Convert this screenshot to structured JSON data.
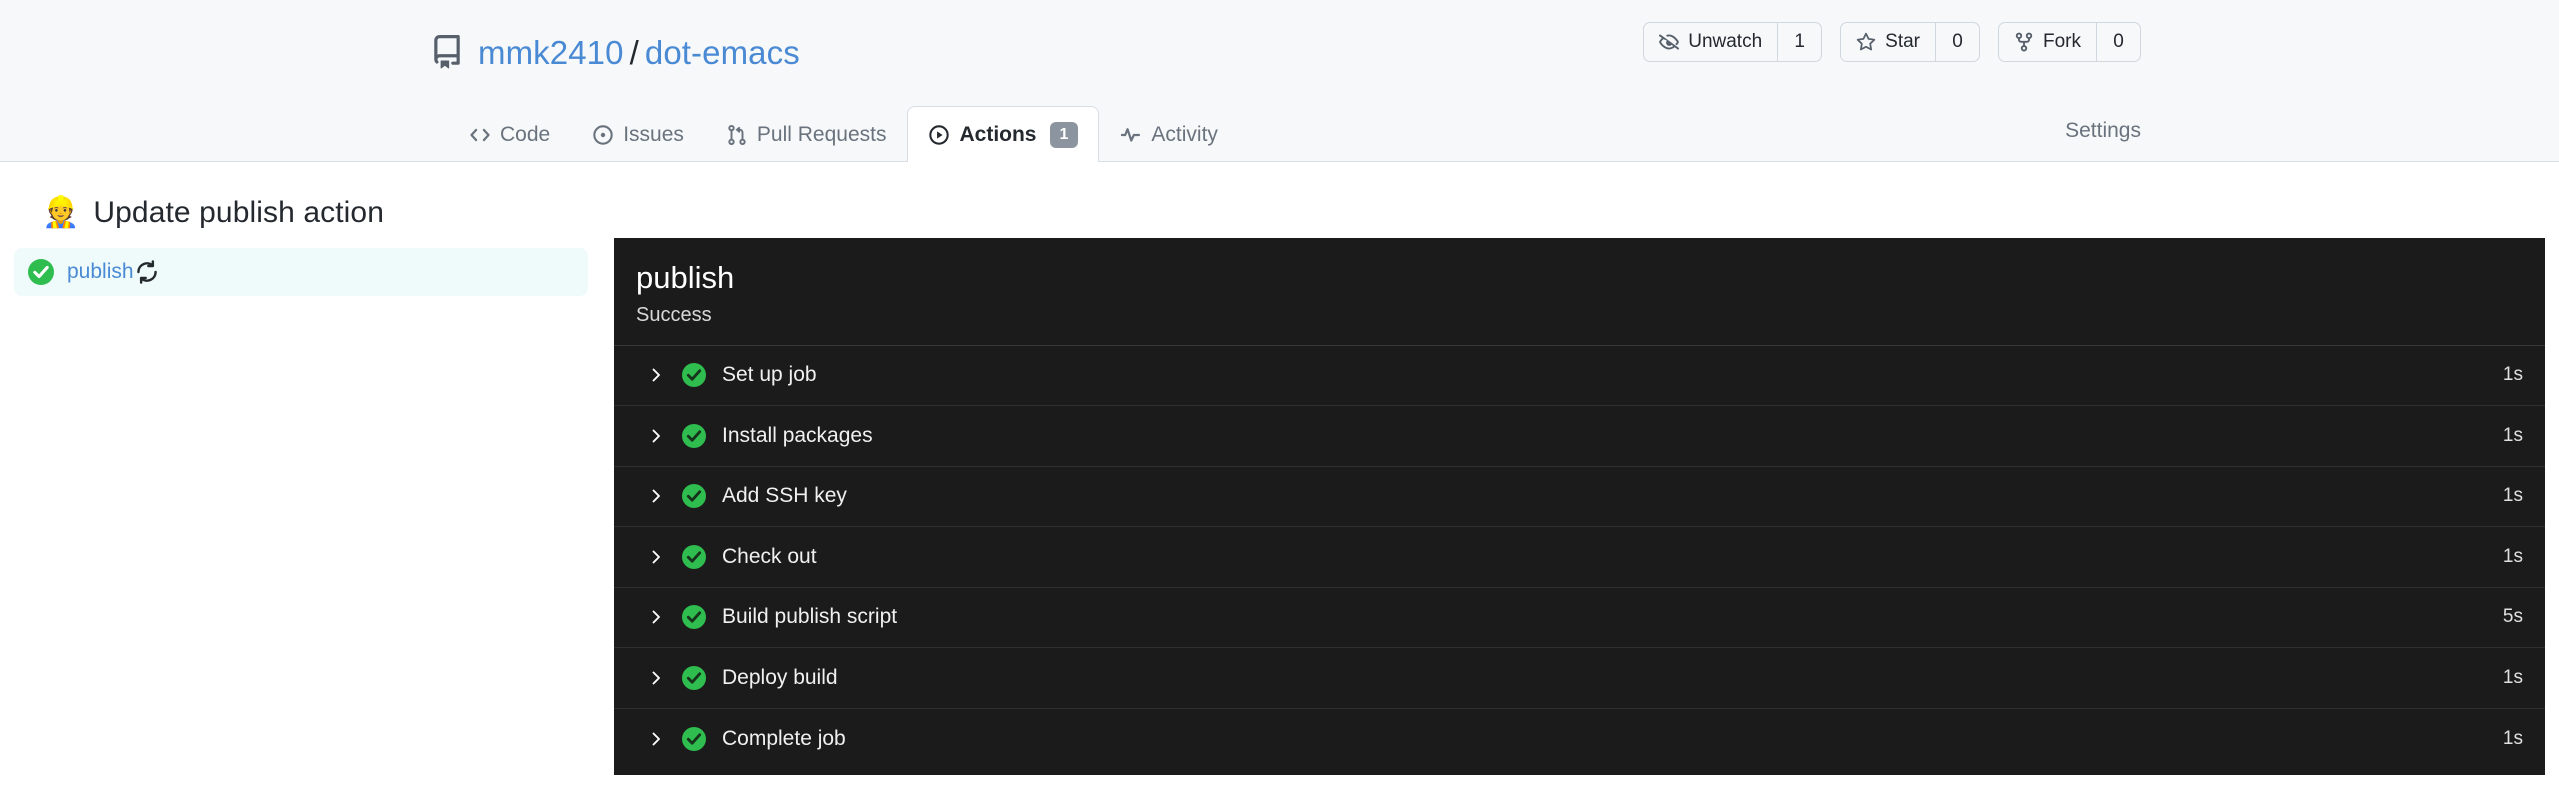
{
  "header": {
    "repo_icon": "repo-book-icon",
    "owner": "mmk2410",
    "separator": "/",
    "repo": "dot-emacs",
    "actions": [
      {
        "icon": "eye-closed-icon",
        "label": "Unwatch",
        "count": "1"
      },
      {
        "icon": "star-icon",
        "label": "Star",
        "count": "0"
      },
      {
        "icon": "fork-icon",
        "label": "Fork",
        "count": "0"
      }
    ],
    "tabs": [
      {
        "icon": "code-icon",
        "label": "Code",
        "badge": "",
        "active": false
      },
      {
        "icon": "issue-opened-icon",
        "label": "Issues",
        "badge": "",
        "active": false
      },
      {
        "icon": "git-pull-request-icon",
        "label": "Pull Requests",
        "badge": "",
        "active": false
      },
      {
        "icon": "play-circle-icon",
        "label": "Actions",
        "badge": "1",
        "active": true
      },
      {
        "icon": "pulse-icon",
        "label": "Activity",
        "badge": "",
        "active": false
      }
    ],
    "settings": {
      "icon": "wrench-icon",
      "label": "Settings"
    }
  },
  "page": {
    "emoji": "👷",
    "title": "Update publish action"
  },
  "sidebar": {
    "jobs": [
      {
        "status_icon": "check-circle-green-icon",
        "name": "publish",
        "rerun_icon": "rerun-sync-icon",
        "selected": true
      }
    ]
  },
  "log": {
    "title": "publish",
    "status": "Success",
    "steps": [
      {
        "chevron": "chevron-right-icon",
        "status_icon": "check-circle-green-icon",
        "label": "Set up job",
        "duration": "1s"
      },
      {
        "chevron": "chevron-right-icon",
        "status_icon": "check-circle-green-icon",
        "label": "Install packages",
        "duration": "1s"
      },
      {
        "chevron": "chevron-right-icon",
        "status_icon": "check-circle-green-icon",
        "label": "Add SSH key",
        "duration": "1s"
      },
      {
        "chevron": "chevron-right-icon",
        "status_icon": "check-circle-green-icon",
        "label": "Check out",
        "duration": "1s"
      },
      {
        "chevron": "chevron-right-icon",
        "status_icon": "check-circle-green-icon",
        "label": "Build publish script",
        "duration": "5s"
      },
      {
        "chevron": "chevron-right-icon",
        "status_icon": "check-circle-green-icon",
        "label": "Deploy build",
        "duration": "1s"
      },
      {
        "chevron": "chevron-right-icon",
        "status_icon": "check-circle-green-icon",
        "label": "Complete job",
        "duration": "1s"
      }
    ]
  },
  "colors": {
    "header_bg": "#f6f8fa",
    "link_blue": "#4a8ad4",
    "success_green": "#2ebd4e",
    "log_bg": "#1b1b1b",
    "selected_job_bg": "#effbfb",
    "badge_gray": "#8c959f"
  }
}
